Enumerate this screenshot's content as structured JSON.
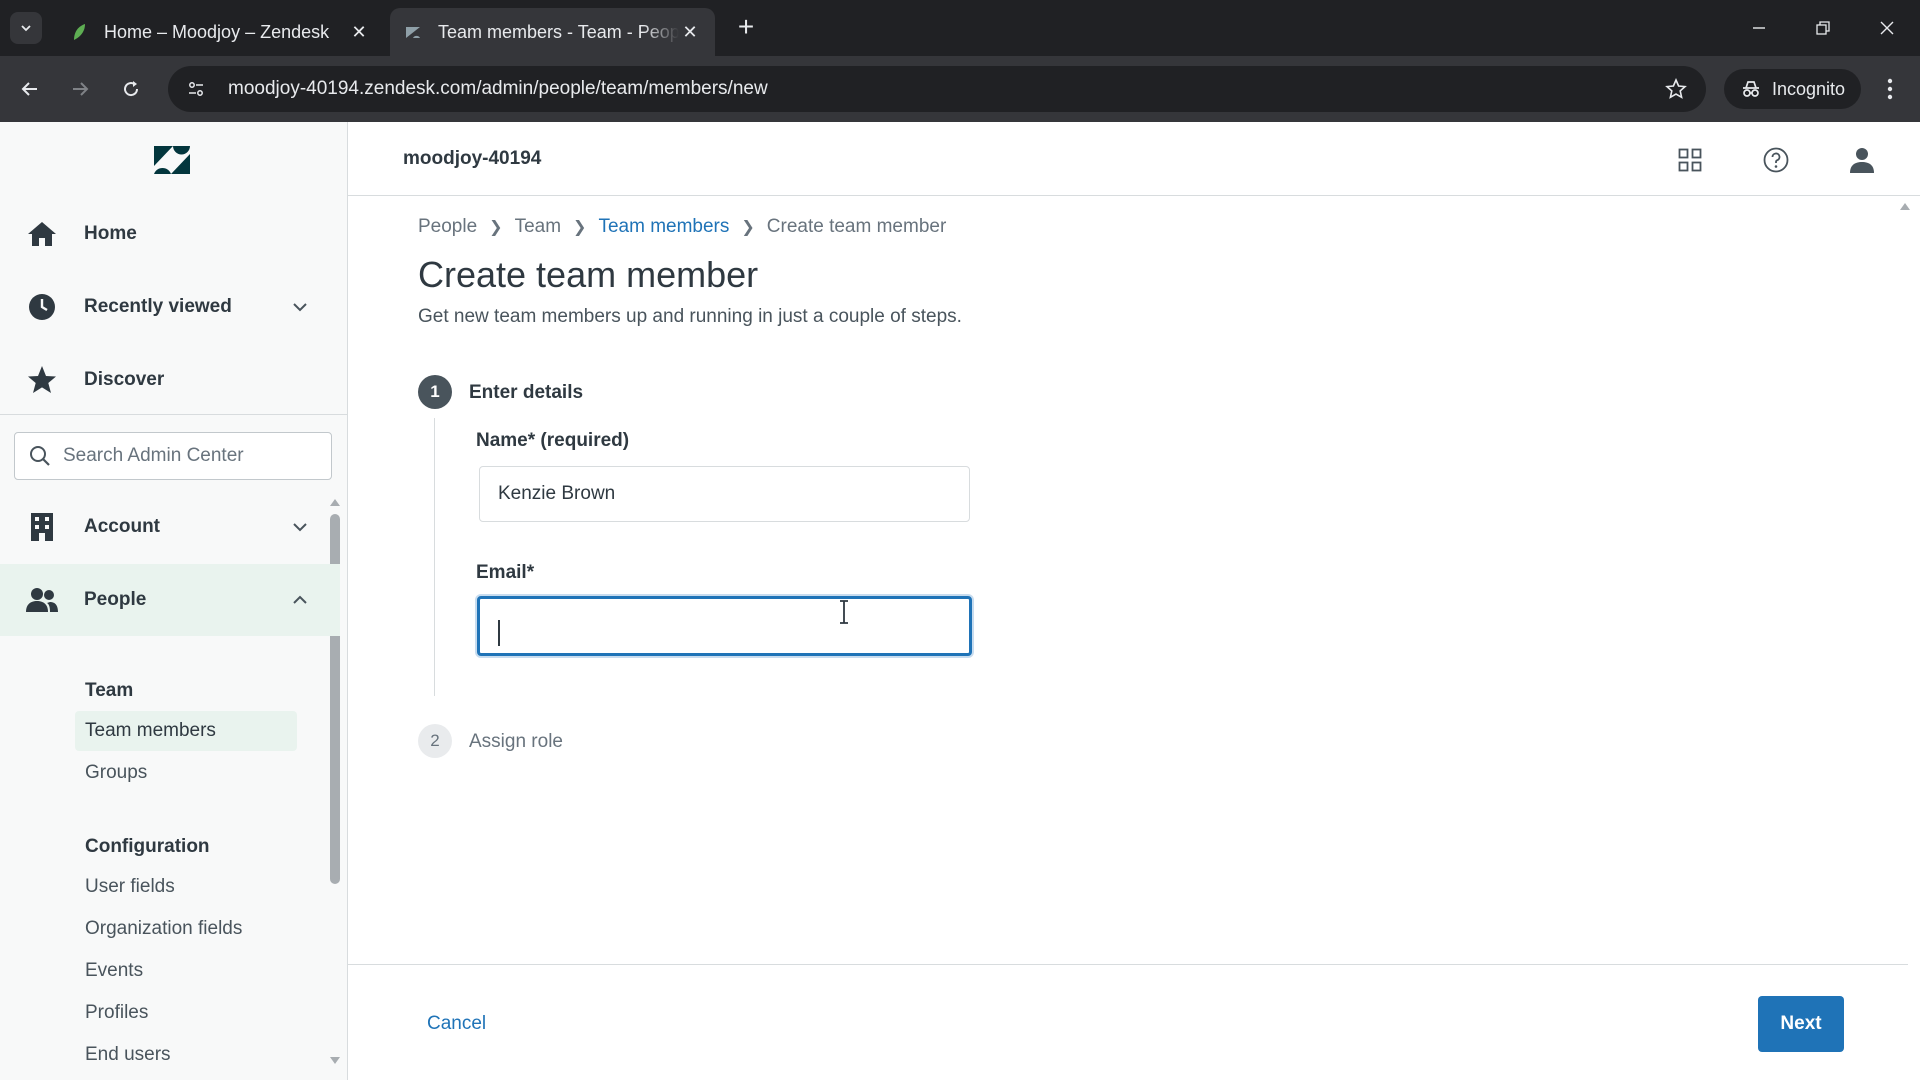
{
  "browser": {
    "tabs": [
      {
        "title": "Home – Moodjoy – Zendesk",
        "active": false
      },
      {
        "title": "Team members - Team - People",
        "active": true
      }
    ],
    "url": "moodjoy-40194.zendesk.com/admin/people/team/members/new",
    "incognito_label": "Incognito"
  },
  "header": {
    "account_name": "moodjoy-40194"
  },
  "sidebar": {
    "primary": [
      {
        "label": "Home",
        "icon": "home-icon"
      },
      {
        "label": "Recently viewed",
        "icon": "clock-icon",
        "expandable": true
      },
      {
        "label": "Discover",
        "icon": "star-icon"
      }
    ],
    "search": {
      "placeholder": "Search Admin Center",
      "value": ""
    },
    "sections": [
      {
        "label": "Account",
        "icon": "building-icon",
        "expanded": false
      },
      {
        "label": "People",
        "icon": "people-icon",
        "expanded": true
      }
    ],
    "people_menu": {
      "team_heading": "Team",
      "team_links": [
        "Team members",
        "Groups"
      ],
      "config_heading": "Configuration",
      "config_links": [
        "User fields",
        "Organization fields",
        "Events",
        "Profiles",
        "End users"
      ],
      "current": "Team members"
    }
  },
  "main": {
    "breadcrumb": [
      "People",
      "Team",
      "Team members",
      "Create team member"
    ],
    "title": "Create team member",
    "subtitle": "Get new team members up and running in just a couple of steps.",
    "steps": [
      {
        "number": "1",
        "label": "Enter details",
        "active": true
      },
      {
        "number": "2",
        "label": "Assign role",
        "active": false
      }
    ],
    "form": {
      "name_label": "Name* (required)",
      "name_value": "Kenzie Brown",
      "email_label": "Email*",
      "email_value": ""
    }
  },
  "footer": {
    "cancel_label": "Cancel",
    "next_label": "Next"
  },
  "colors": {
    "accent": "#1f73b7",
    "sidebar_selected": "#e9f3ee",
    "chrome_dark": "#202124",
    "chrome_toolbar": "#35363a"
  }
}
